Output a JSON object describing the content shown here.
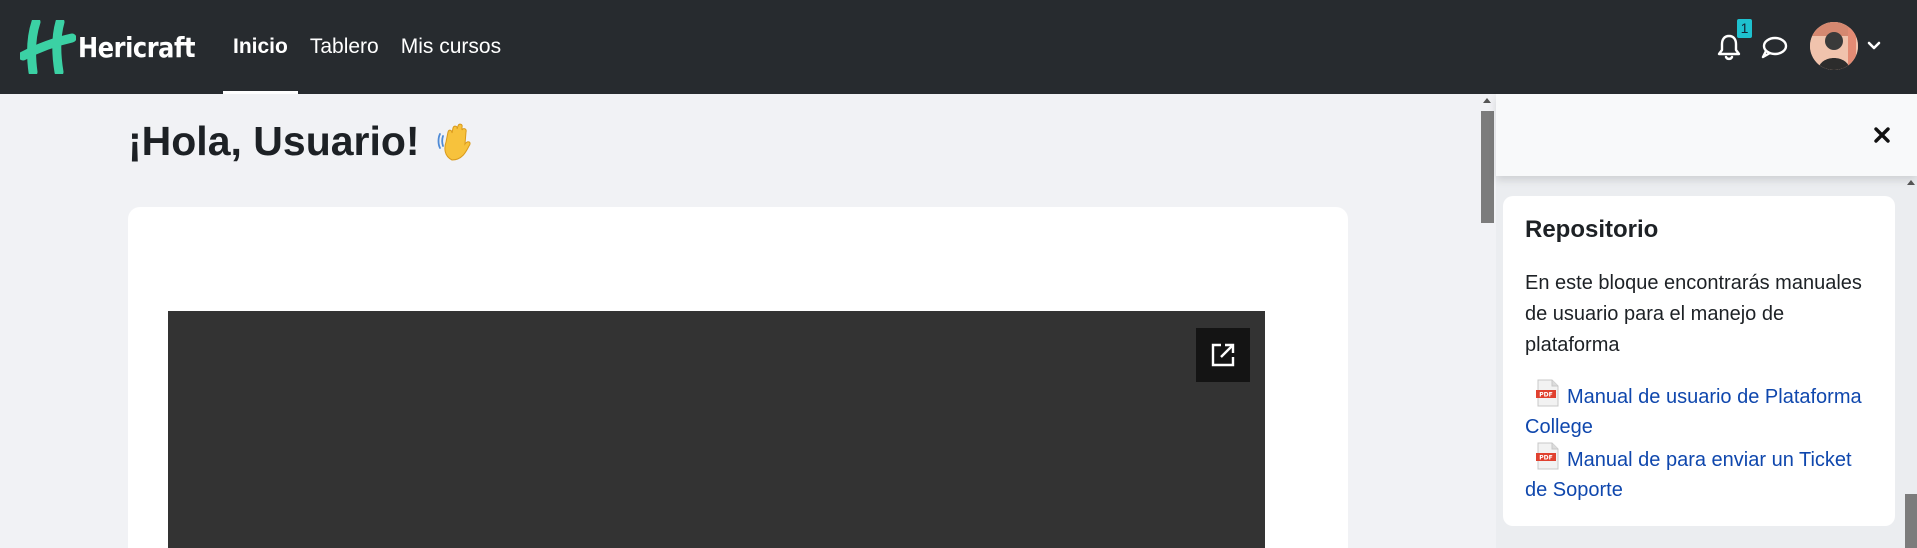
{
  "navbar": {
    "brand": "Hericraft",
    "links": [
      {
        "label": "Inicio",
        "active": true
      },
      {
        "label": "Tablero",
        "active": false
      },
      {
        "label": "Mis cursos",
        "active": false
      }
    ],
    "notification_count": "1",
    "icons": [
      "bell-icon",
      "chat-icon",
      "chevron-down-icon"
    ]
  },
  "main": {
    "greeting": "¡Hola, Usuario!",
    "greeting_icon": "waving-hand-emoji",
    "video_action_icon": "open-external-icon"
  },
  "drawer": {
    "close_icon": "close-icon",
    "block": {
      "title": "Repositorio",
      "description": "En este bloque encontrarás manuales de usuario para el manejo de plataforma",
      "files": [
        {
          "label": "Manual de usuario de Plataforma College",
          "icon": "pdf-icon"
        },
        {
          "label": "Manual de para enviar un Ticket de Soporte",
          "icon": "pdf-icon"
        }
      ]
    }
  },
  "colors": {
    "navbar_bg": "#272b2f",
    "brand_accent": "#3bd1a4",
    "badge": "#1ec1cf",
    "link": "#0f47ad"
  }
}
